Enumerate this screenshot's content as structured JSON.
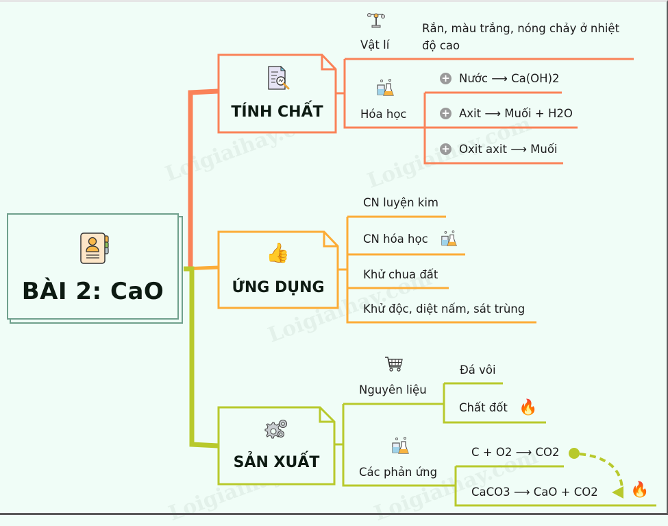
{
  "colors": {
    "background": "#f0fdf7",
    "root_border": "#6fa08c",
    "branch_properties": "#fa8258",
    "branch_applications": "#fcac37",
    "branch_production": "#b8c92c"
  },
  "watermark": "Loigiaihay.com",
  "root": {
    "title": "BÀI 2: CaO",
    "icon": "contact-card-icon"
  },
  "branches": [
    {
      "id": "properties",
      "title": "TÍNH CHẤT",
      "icon": "document-search-icon",
      "children": [
        {
          "label": "Vật lí",
          "icon": "balance-scale-icon",
          "items": [
            {
              "text": "Rắn, màu trắng, nóng chảy ở nhiệt độ cao"
            }
          ]
        },
        {
          "label": "Hóa học",
          "icon": "chemistry-flask-icon",
          "items": [
            {
              "text": "Nước ⟶ Ca(OH)2",
              "expand_icon": "plus-circle-icon"
            },
            {
              "text": "Axit ⟶ Muối + H2O",
              "expand_icon": "plus-circle-icon"
            },
            {
              "text": "Oxit axit ⟶ Muối",
              "expand_icon": "plus-circle-icon"
            }
          ]
        }
      ]
    },
    {
      "id": "applications",
      "title": "ỨNG DỤNG",
      "icon": "thumbs-up-icon",
      "items": [
        {
          "text": "CN luyện kim"
        },
        {
          "text": "CN hóa học",
          "icon": "chemistry-flask-icon"
        },
        {
          "text": "Khử chua đất"
        },
        {
          "text": "Khử độc, diệt nấm, sát trùng"
        }
      ]
    },
    {
      "id": "production",
      "title": "SẢN XUẤT",
      "icon": "gears-icon",
      "children": [
        {
          "label": "Nguyên liệu",
          "icon": "shopping-cart-icon",
          "items": [
            {
              "text": "Đá vôi"
            },
            {
              "text": "Chất đốt",
              "icon": "fire-icon"
            }
          ]
        },
        {
          "label": "Các phản ứng",
          "icon": "chemistry-flask-icon",
          "items": [
            {
              "text": "C + O2 ⟶ CO2"
            },
            {
              "text": "CaCO3 ⟶ CaO + CO2",
              "icon": "fire-icon"
            }
          ]
        }
      ],
      "relationship": {
        "from": "C + O2 ⟶ CO2",
        "to": "CaCO3 ⟶ CaO + CO2",
        "style": "dashed-arrow"
      }
    }
  ]
}
